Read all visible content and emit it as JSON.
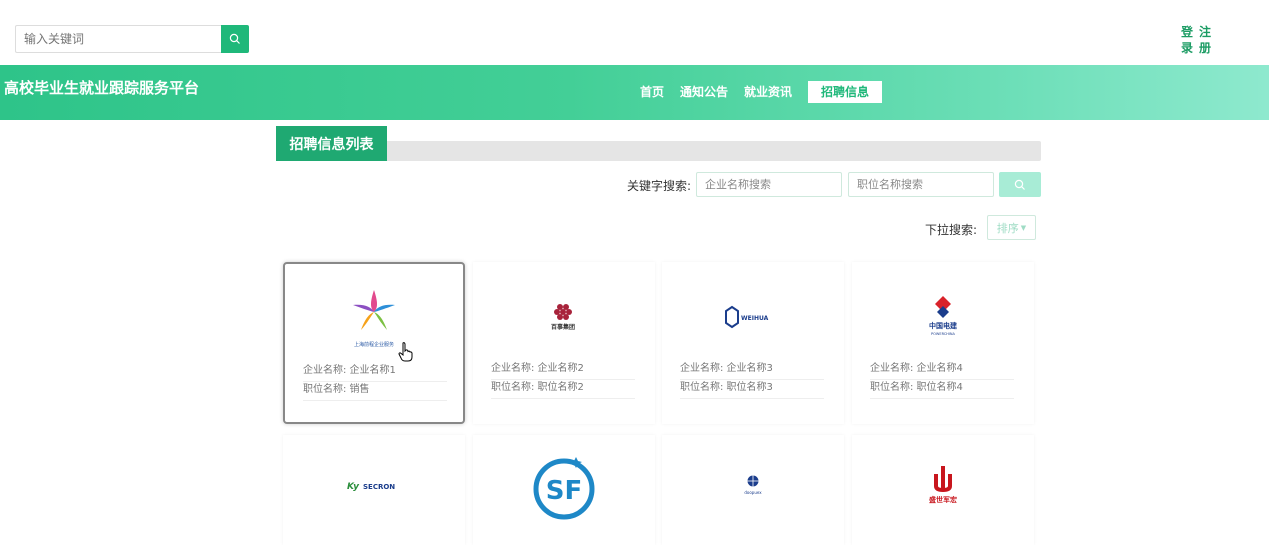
{
  "header": {
    "search_placeholder": "输入关键词",
    "auth": [
      "登",
      "注",
      "录",
      "册"
    ]
  },
  "navbar": {
    "brand": "高校毕业生就业跟踪服务平台",
    "items": [
      {
        "label": "首页"
      },
      {
        "label": "通知公告"
      },
      {
        "label": "就业资讯"
      },
      {
        "label": "招聘信息",
        "active": true
      }
    ]
  },
  "list": {
    "tab_title": "招聘信息列表",
    "keyword_label": "关键字搜索:",
    "company_placeholder": "企业名称搜索",
    "position_placeholder": "职位名称搜索",
    "dropdown_label": "下拉搜索:",
    "sort_label": "排序"
  },
  "cards": [
    {
      "company": "企业名称: 企业名称1",
      "position": "职位名称: 销售",
      "logo_text": "上海前程企业服务",
      "logo": "star-logo"
    },
    {
      "company": "企业名称: 企业名称2",
      "position": "职位名称: 职位名称2",
      "logo_text": "百事集团",
      "logo": "grape-logo"
    },
    {
      "company": "企业名称: 企业名称3",
      "position": "职位名称: 职位名称3",
      "logo_text": "WEIHUA",
      "logo": "weihua-logo"
    },
    {
      "company": "企业名称: 企业名称4",
      "position": "职位名称: 职位名称4",
      "logo_text": "中国电建",
      "logo_sub": "POWERCHINA",
      "logo": "powerchina-logo"
    }
  ],
  "cards_row2": [
    {
      "logo_text": "SECRON",
      "logo": "secron-logo"
    },
    {
      "logo_text": "SF",
      "logo": "sf-logo"
    },
    {
      "logo_text": "doopuex",
      "logo": "globe-logo"
    },
    {
      "logo_text": "盛世军宏",
      "logo": "shengshi-logo"
    }
  ],
  "colors": {
    "accent": "#1fb87a",
    "tab_green": "#1fa972",
    "nav_gradient_start": "#2ec489",
    "nav_gradient_end": "#8ee9ce"
  }
}
